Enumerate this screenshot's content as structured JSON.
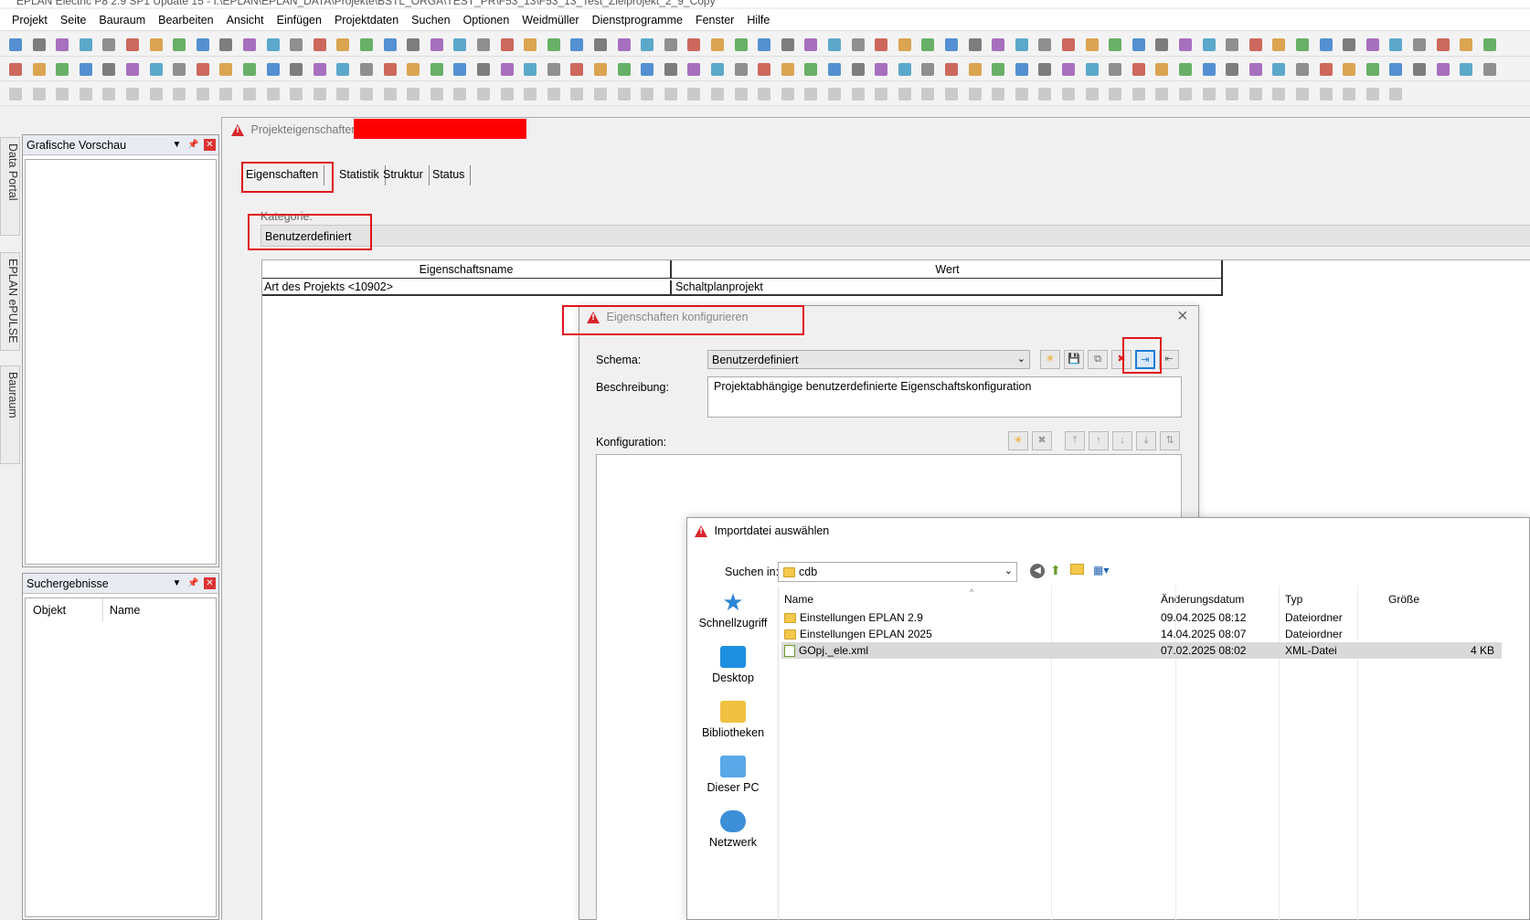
{
  "titlebar": {
    "text": "EPLAN Electric P8 2.9 SP1 Update 15 - I:\\EPLAN\\EPLAN_DATA\\Projekte\\BSTL_ORGA\\TEST_PR\\F53_13\\F53_13_Test_Zielprojekt_2_9_Copy"
  },
  "menu": [
    "Projekt",
    "Seite",
    "Bauraum",
    "Bearbeiten",
    "Ansicht",
    "Einfügen",
    "Projektdaten",
    "Suchen",
    "Optionen",
    "Weidmüller",
    "Dienstprogramme",
    "Fenster",
    "Hilfe"
  ],
  "side_tabs": {
    "data_portal": "Data Portal",
    "epulse": "EPLAN ePULSE",
    "bauraum": "Bauraum"
  },
  "preview_panel": {
    "title": "Grafische Vorschau"
  },
  "search_panel": {
    "title": "Suchergebnisse",
    "col_object": "Objekt",
    "col_name": "Name"
  },
  "project_props": {
    "title": "Projekteigenschaften:",
    "tabs": [
      "Eigenschaften",
      "Statistik",
      "Struktur",
      "Status"
    ],
    "category_label": "Kategorie:",
    "category_value": "Benutzerdefiniert",
    "col_name": "Eigenschaftsname",
    "col_value": "Wert",
    "row_name": "Art des Projekts <10902>",
    "row_value": "Schaltplanprojekt"
  },
  "config_dialog": {
    "title": "Eigenschaften konfigurieren",
    "schema_label": "Schema:",
    "schema_value": "Benutzerdefiniert",
    "description_label": "Beschreibung:",
    "description_value": "Projektabhängige benutzerdefinierte Eigenschaftskonfiguration",
    "configuration_label": "Konfiguration:"
  },
  "import_dialog": {
    "title": "Importdatei auswählen",
    "look_in_label": "Suchen in:",
    "look_in_value": "cdb",
    "quick_access": [
      "Schnellzugriff",
      "Desktop",
      "Bibliotheken",
      "Dieser PC",
      "Netzwerk"
    ],
    "columns": {
      "name": "Name",
      "date": "Änderungsdatum",
      "type": "Typ",
      "size": "Größe"
    },
    "files": [
      {
        "name": "Einstellungen EPLAN 2.9",
        "date": "09.04.2025 08:12",
        "type": "Dateiordner",
        "size": ""
      },
      {
        "name": "Einstellungen EPLAN 2025",
        "date": "14.04.2025 08:07",
        "type": "Dateiordner",
        "size": ""
      },
      {
        "name": "GOpj._ele.xml",
        "date": "07.02.2025 08:02",
        "type": "XML-Datei",
        "size": "4 KB"
      }
    ]
  },
  "colors": {
    "highlight_box": "#e0141b",
    "redaction": "#ff0000",
    "accent": "#0078d7"
  }
}
